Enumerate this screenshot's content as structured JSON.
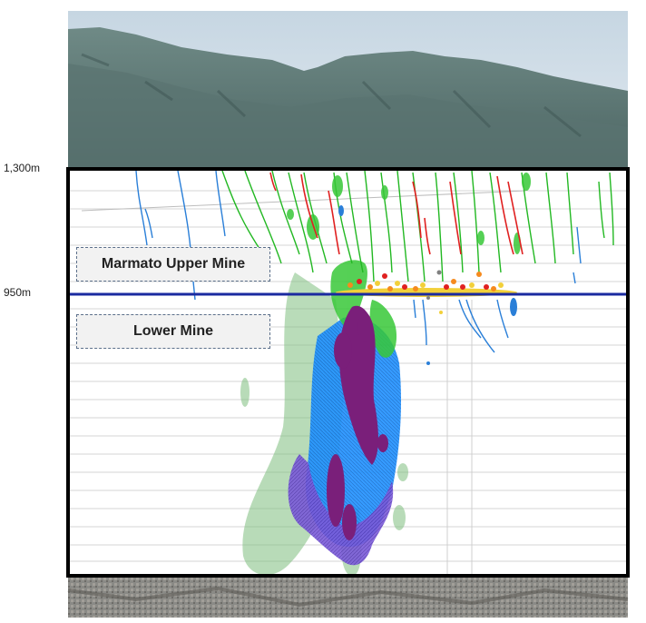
{
  "elevation_labels": {
    "top": "1,300m",
    "mid": "950m"
  },
  "mine_labels": {
    "upper": "Marmato Upper Mine",
    "lower": "Lower Mine"
  },
  "colors": {
    "frame": "#000000",
    "level_line": "#1a2aa0",
    "green_vein": "#22b822",
    "red_vein": "#e02020",
    "blue_vein": "#2a7fd8",
    "deposit_green": "#7fbf7f",
    "deposit_blue": "#1e90ff",
    "deposit_violet": "#7a4fd0",
    "deposit_purple": "#7a1f7a"
  }
}
